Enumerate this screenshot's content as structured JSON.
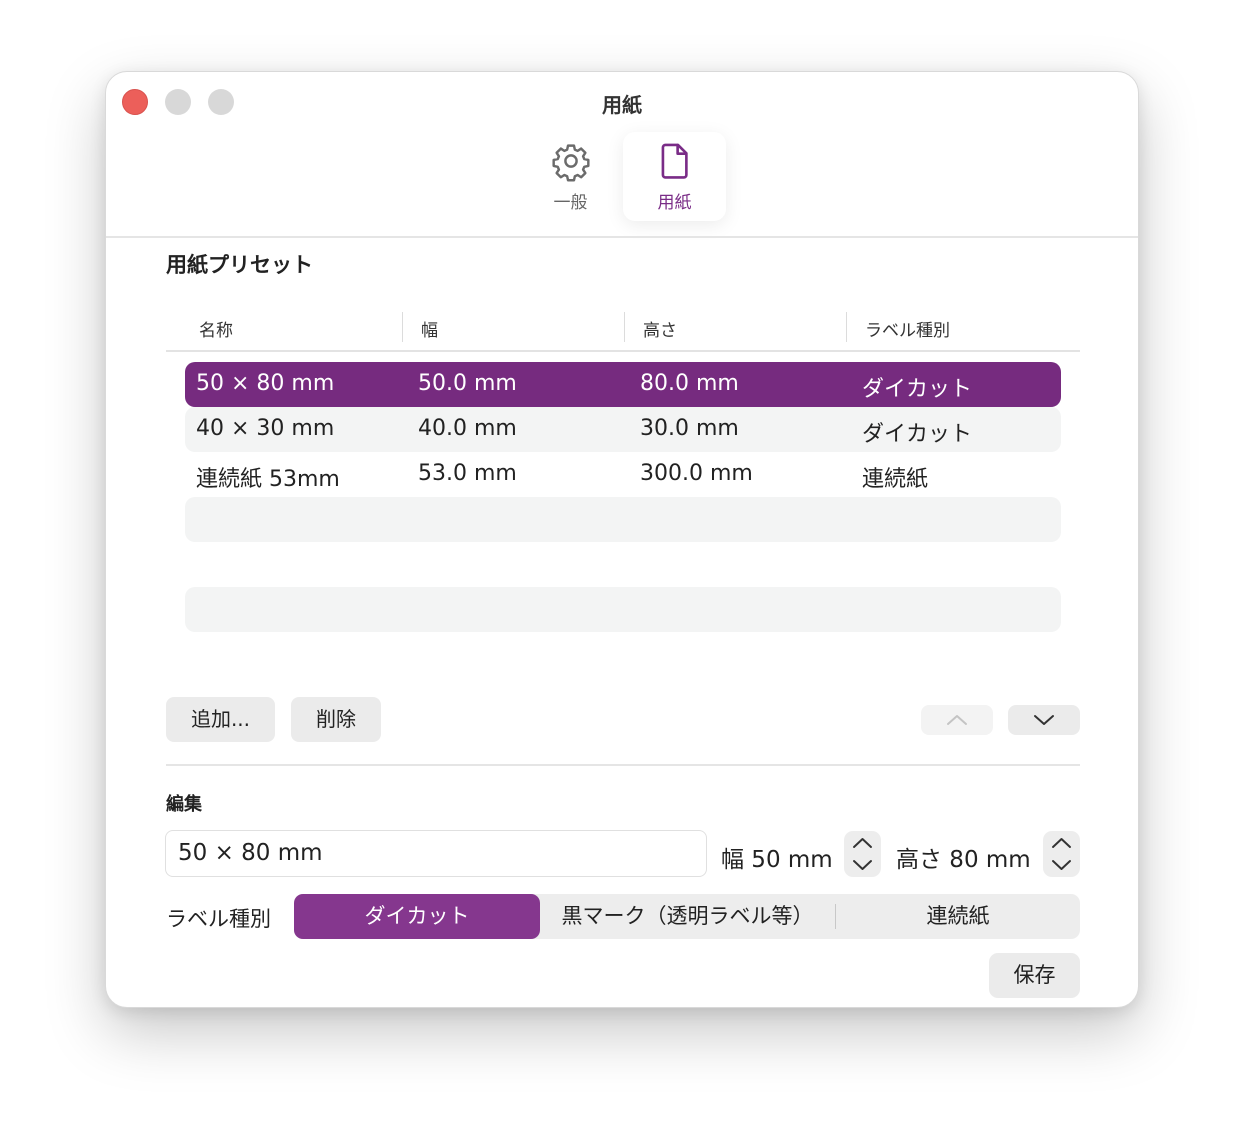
{
  "window": {
    "title": "用紙"
  },
  "toolbar": {
    "items": [
      {
        "label": "一般",
        "icon": "gear-icon",
        "selected": false
      },
      {
        "label": "用紙",
        "icon": "document-icon",
        "selected": true
      }
    ]
  },
  "presets": {
    "section_title": "用紙プリセット",
    "columns": [
      "名称",
      "幅",
      "高さ",
      "ラベル種別"
    ],
    "rows": [
      {
        "name": "50 × 80 mm",
        "width": "50.0 mm",
        "height": "80.0 mm",
        "kind": "ダイカット",
        "selected": true
      },
      {
        "name": "40 × 30 mm",
        "width": "40.0 mm",
        "height": "30.0 mm",
        "kind": "ダイカット",
        "selected": false
      },
      {
        "name": "連続紙 53mm",
        "width": "53.0 mm",
        "height": "300.0 mm",
        "kind": "連続紙",
        "selected": false
      }
    ],
    "add_label": "追加...",
    "delete_label": "削除"
  },
  "edit": {
    "section_title": "編集",
    "name_value": "50 × 80 mm",
    "width_label": "幅 50 mm",
    "height_label": "高さ 80 mm",
    "label_kind_title": "ラベル種別",
    "label_kind_options": [
      "ダイカット",
      "黒マーク（透明ラベル等）",
      "連続紙"
    ],
    "label_kind_selected": "ダイカット",
    "save_label": "保存"
  },
  "colors": {
    "accent": "#762b7f",
    "segment_active": "#85378e",
    "close_button": "#ec5f5a"
  }
}
